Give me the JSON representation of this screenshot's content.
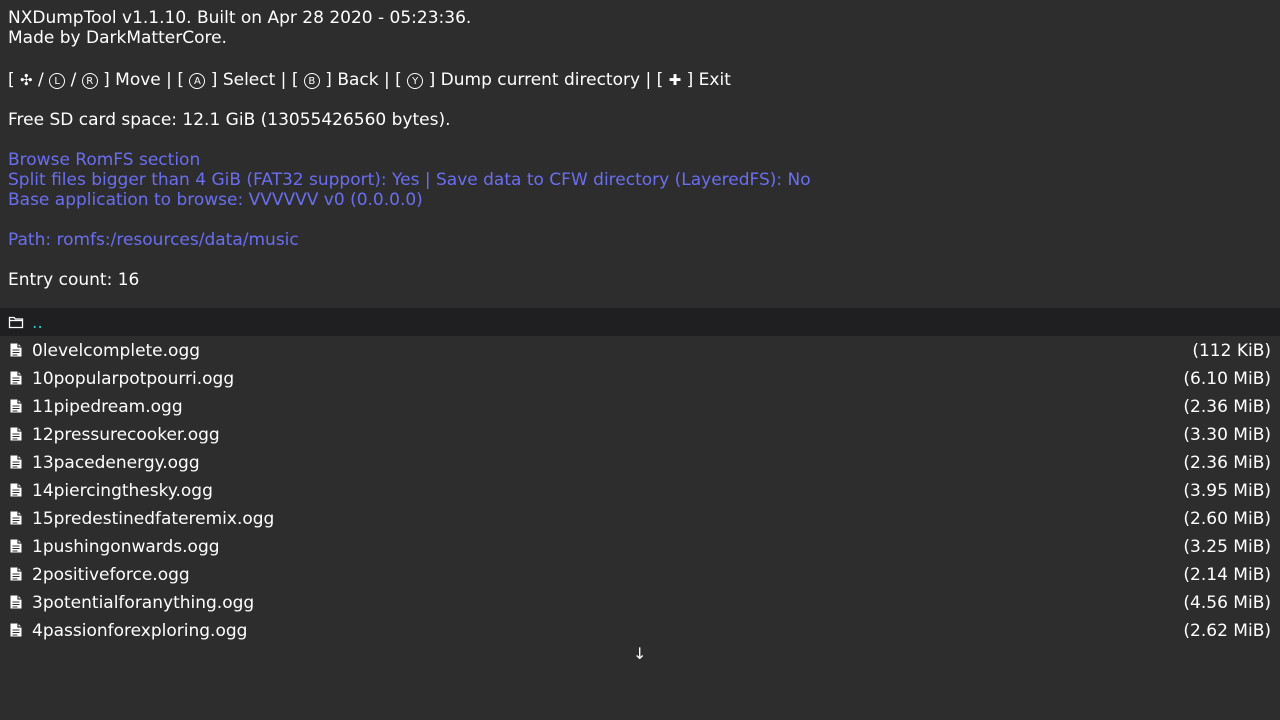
{
  "header": {
    "title": "NXDumpTool v1.1.10. Built on Apr 28 2020 - 05:23:36.",
    "author": "Made by DarkMatterCore."
  },
  "controls": {
    "open_bracket": "[",
    "close_bracket": "]",
    "slash": "/",
    "pipe": "|",
    "dpad_glyph": "✣",
    "lstick_glyph": "L",
    "rstick_glyph": "R",
    "a_glyph": "A",
    "b_glyph": "B",
    "y_glyph": "Y",
    "plus_glyph": "✚",
    "move_label": "Move",
    "select_label": "Select",
    "back_label": "Back",
    "dump_label": "Dump current directory",
    "exit_label": "Exit"
  },
  "sd_space": "Free SD card space: 12.1 GiB (13055426560 bytes).",
  "romfs": {
    "section_title": "Browse RomFS section",
    "split_info": "Split files bigger than 4 GiB (FAT32 support): Yes | Save data to CFW directory (LayeredFS): No",
    "base_app": "Base application to browse: VVVVVV v0 (0.0.0.0)",
    "path": "Path: romfs:/resources/data/music"
  },
  "entry_count": "Entry count: 16",
  "parent_entry": {
    "icon": "folder-icon",
    "name": ".."
  },
  "files": [
    {
      "name": "0levelcomplete.ogg",
      "size": "(112 KiB)"
    },
    {
      "name": "10popularpotpourri.ogg",
      "size": "(6.10 MiB)"
    },
    {
      "name": "11pipedream.ogg",
      "size": "(2.36 MiB)"
    },
    {
      "name": "12pressurecooker.ogg",
      "size": "(3.30 MiB)"
    },
    {
      "name": "13pacedenergy.ogg",
      "size": "(2.36 MiB)"
    },
    {
      "name": "14piercingthesky.ogg",
      "size": "(3.95 MiB)"
    },
    {
      "name": "15predestinedfateremix.ogg",
      "size": "(2.60 MiB)"
    },
    {
      "name": "1pushingonwards.ogg",
      "size": "(3.25 MiB)"
    },
    {
      "name": "2positiveforce.ogg",
      "size": "(2.14 MiB)"
    },
    {
      "name": "3potentialforanything.ogg",
      "size": "(4.56 MiB)"
    },
    {
      "name": "4passionforexploring.ogg",
      "size": "(2.62 MiB)"
    }
  ],
  "scroll_indicator": "↓",
  "colors": {
    "background": "#2d2d2d",
    "text": "#ffffff",
    "accent_blue": "#6a6ef0",
    "highlight_cyan": "#14d2c8",
    "selected_row": "#1f1f22"
  }
}
